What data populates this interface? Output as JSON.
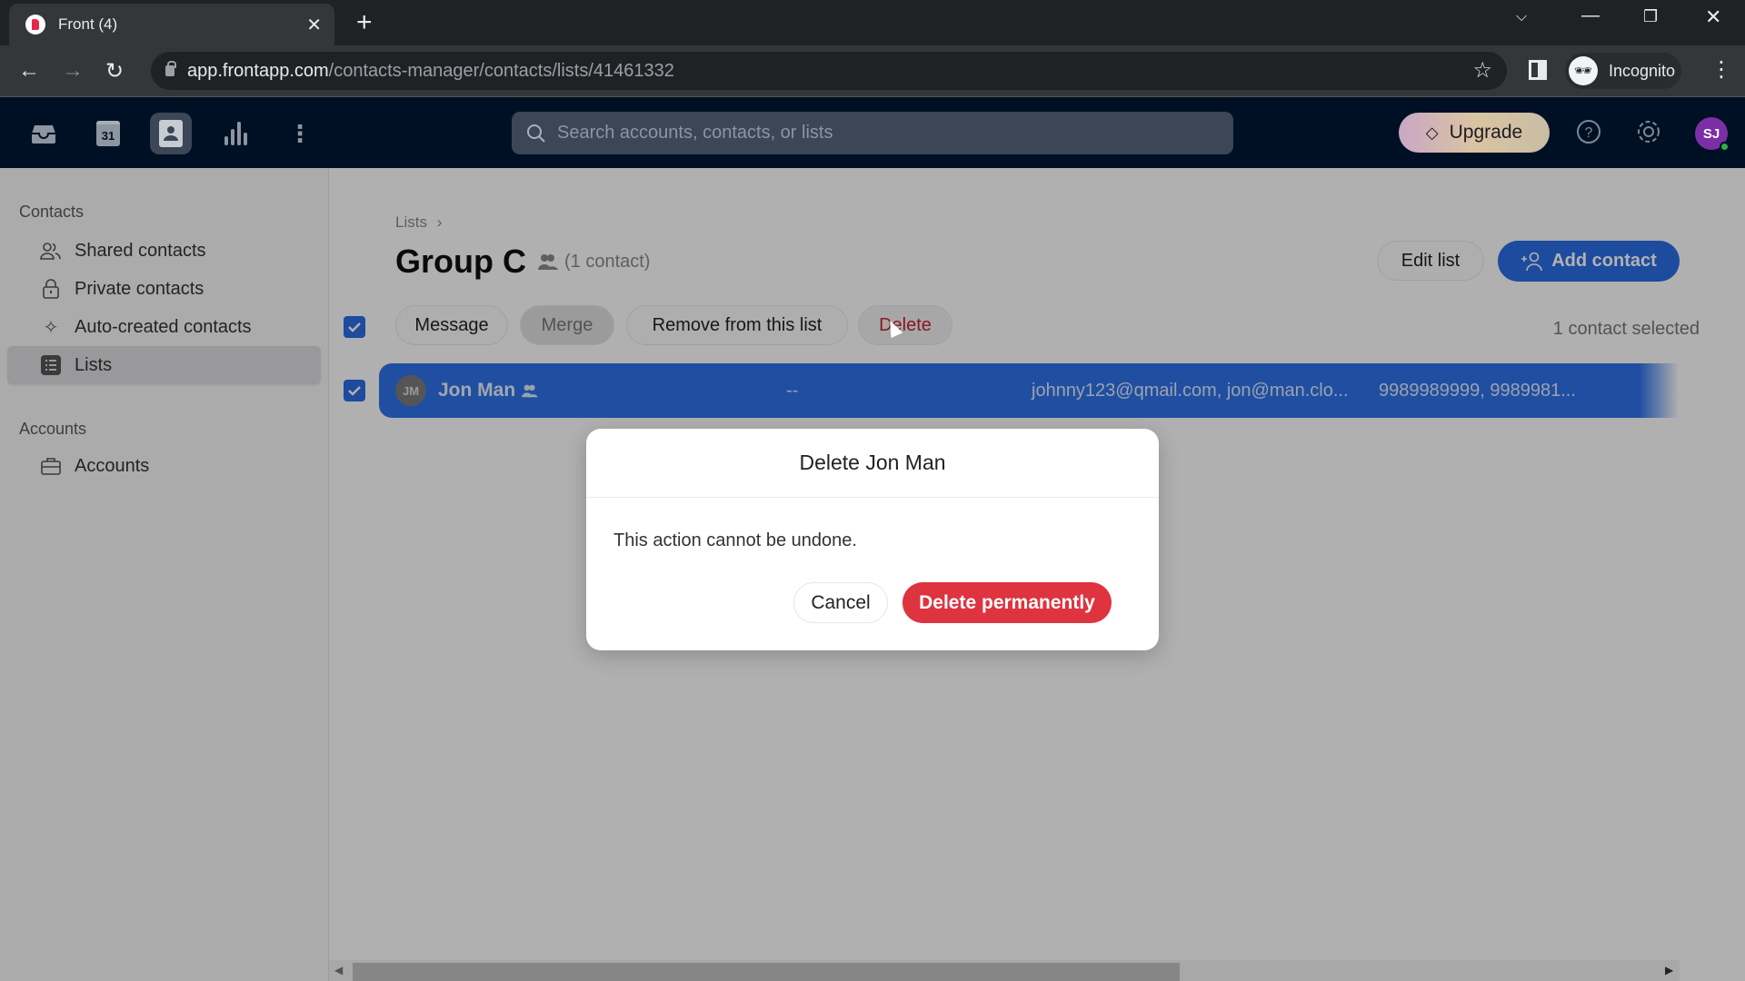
{
  "browser": {
    "tab_title": "Front (4)",
    "url_host": "app.frontapp.com",
    "url_path": "/contacts-manager/contacts/lists/41461332",
    "profile_label": "Incognito"
  },
  "app_header": {
    "nav_icons": [
      "inbox-icon",
      "calendar-icon",
      "contacts-icon",
      "analytics-icon",
      "more-icon"
    ],
    "calendar_day": "31",
    "search_placeholder": "Search accounts, contacts, or lists",
    "upgrade_label": "Upgrade",
    "avatar_initials": "SJ",
    "colors": {
      "header_bg": "#001024",
      "avatar_bg": "#7b2fa6",
      "status_online": "#2fae4d"
    }
  },
  "sidebar": {
    "contacts_section": "Contacts",
    "items": [
      {
        "label": "Shared contacts",
        "icon": "shared-contacts-icon"
      },
      {
        "label": "Private contacts",
        "icon": "lock-icon"
      },
      {
        "label": "Auto-created contacts",
        "icon": "sparkle-icon"
      },
      {
        "label": "Lists",
        "icon": "list-icon",
        "active": true
      }
    ],
    "accounts_section": "Accounts",
    "account_items": [
      {
        "label": "Accounts",
        "icon": "briefcase-icon"
      }
    ]
  },
  "main": {
    "breadcrumb": "Lists",
    "breadcrumb_separator": "›",
    "title": "Group C",
    "contact_count": "(1 contact)",
    "edit_list_label": "Edit list",
    "add_contact_label": "Add contact",
    "actions": {
      "message": "Message",
      "merge": "Merge",
      "remove": "Remove from this list",
      "delete": "Delete"
    },
    "selection_status": "1 contact selected",
    "rows": [
      {
        "initials": "JM",
        "name": "Jon Man",
        "account": "--",
        "emails": "johnny123@qmail.com, jon@man.clo...",
        "phones": "9989989999, 9989981...",
        "selected": true
      }
    ],
    "colors": {
      "primary": "#2a6ce2",
      "danger": "#dd3440"
    }
  },
  "modal": {
    "title": "Delete Jon Man",
    "body": "This action cannot be undone.",
    "cancel_label": "Cancel",
    "confirm_label": "Delete permanently"
  }
}
